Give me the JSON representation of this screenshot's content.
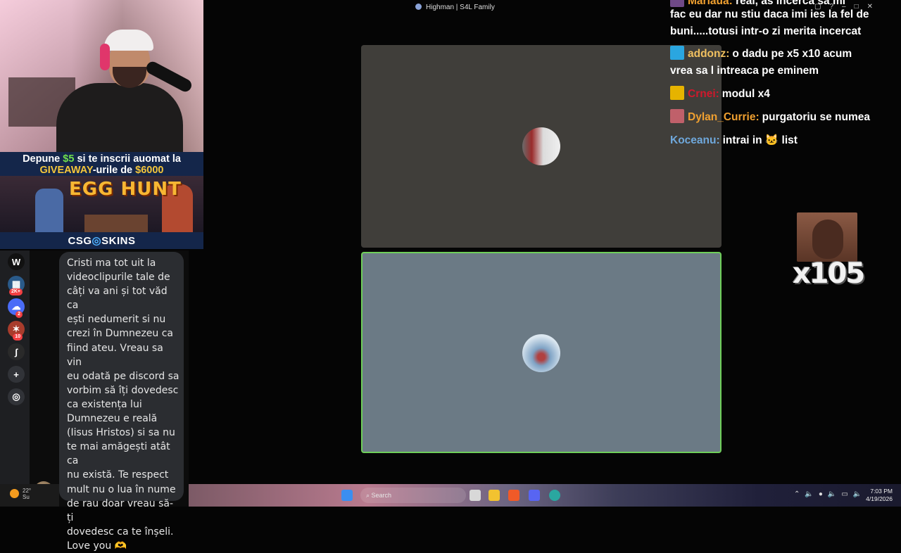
{
  "window": {
    "title": "Highman | S4L Family"
  },
  "promo": {
    "line1_a": "Depune ",
    "line1_amount": "$5",
    "line1_b": " si te inscrii auomat la",
    "line2_a": "GIVEAWAY",
    "line2_b": "-urile de ",
    "line2_amount": "$6000",
    "game_title": "EGG HUNT",
    "brand_a": "CSG",
    "brand_ring": "◎",
    "brand_b": "SKINS"
  },
  "sidebar": {
    "servers": [
      {
        "label": "W",
        "bg": "#111111",
        "badge": ""
      },
      {
        "label": "▦",
        "bg": "#2a5a8a",
        "badge": "2K+"
      },
      {
        "label": "☁",
        "bg": "#4a6cf7",
        "badge": "2"
      },
      {
        "label": "✶",
        "bg": "#a83c2c",
        "badge": "10"
      },
      {
        "label": "ʃ",
        "bg": "#2a2a2a",
        "badge": ""
      },
      {
        "label": "+",
        "bg": "#313338",
        "badge": ""
      },
      {
        "label": "◎",
        "bg": "#313338",
        "badge": ""
      }
    ]
  },
  "message": {
    "lines": [
      "Cristi ma tot uit la",
      "videoclipurile tale de",
      "câți va ani și tot văd ca",
      "ești nedumerit si nu",
      "crezi în Dumnezeu ca",
      "fiind ateu. Vreau sa vin",
      "eu odată pe discord sa",
      "vorbim să îți dovedesc",
      "ca existența lui",
      "Dumnezeu e reală",
      "(Iisus Hristos) si sa nu",
      "te mai amăgești atât ca",
      "nu există. Te respect",
      "mult nu o lua în nume",
      "de rau doar vreau să-ți",
      "dovedesc ca te înșeli.",
      "Love you 🫶"
    ]
  },
  "chat": {
    "partial_top_user": "Mariaua:",
    "partial_top_text": "real, as incerca sa mi",
    "line_cont1": "fac eu dar nu stiu daca imi ies la fel de",
    "line_cont2": "buni.....totusi intr-o zi merita incercat",
    "messages": [
      {
        "user": "addonz:",
        "color": "#f0c060",
        "badge_color": "#2aa6e0",
        "text": "o dadu pe x5 x10 acum"
      },
      {
        "user": "",
        "color": "#ffffff",
        "badge_color": "",
        "text": "vrea sa l intreaca pe eminem"
      },
      {
        "user": "Crnei:",
        "color": "#d0182c",
        "badge_color": "#e6b300",
        "text": "modul x4"
      },
      {
        "user": "Dylan_Currie:",
        "color": "#f0a030",
        "badge_color": "#c0606a",
        "text": "purgatoriu se numea"
      },
      {
        "user": "Koceanu:",
        "color": "#6fa8dc",
        "badge_color": "",
        "text": "intrai in 🐱 list"
      }
    ]
  },
  "emote": {
    "count": "x105"
  },
  "taskbar": {
    "weather_temp": "22°",
    "weather_desc": "Su",
    "search_placeholder": "Search",
    "time": "7:03 PM",
    "date": "4/19/2026"
  },
  "colors": {
    "tile_top": "#403e3a",
    "tile_bottom": "#6b7a85",
    "speaking_border": "#6fcf5a",
    "promo_bg": "#14264a"
  }
}
